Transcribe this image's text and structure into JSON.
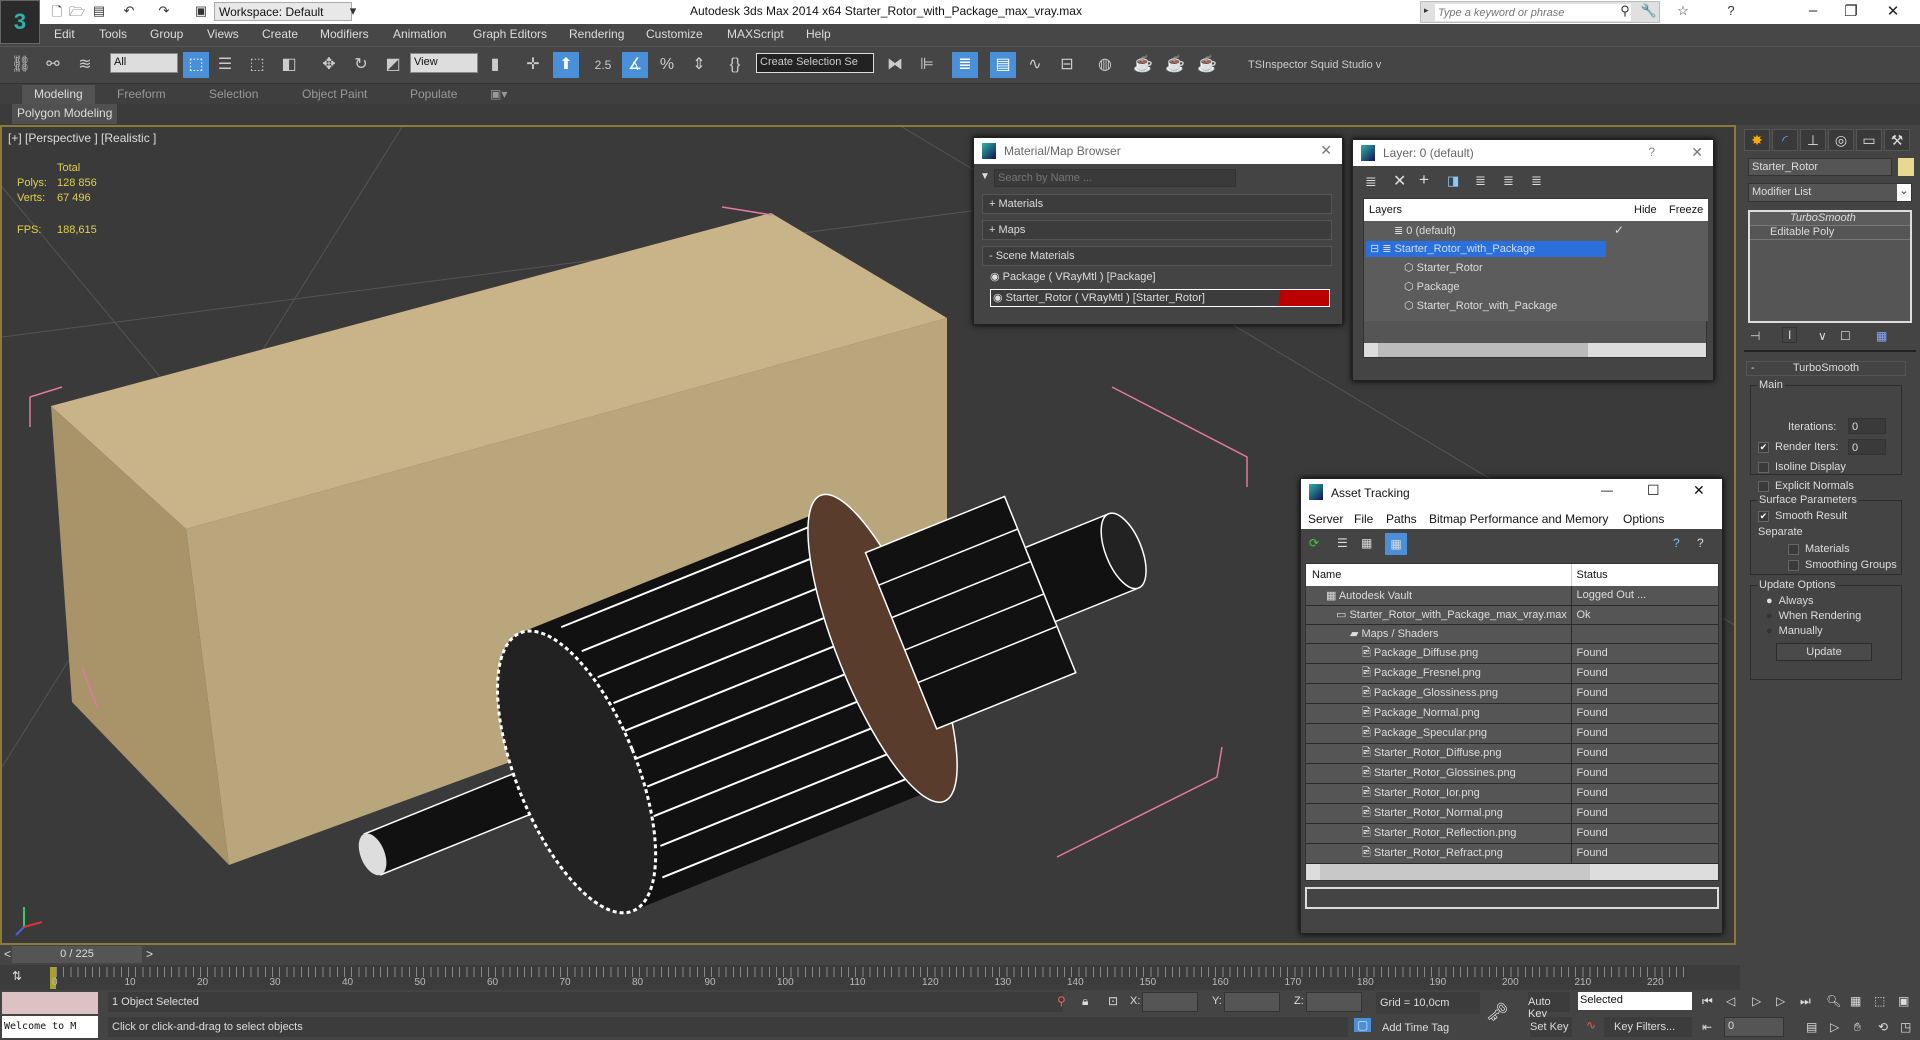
{
  "titlebar": {
    "workspace": "Workspace: Default",
    "title": "Autodesk 3ds Max  2014 x64    Starter_Rotor_with_Package_max_vray.max",
    "search_placeholder": "Type a keyword or phrase"
  },
  "menu": [
    "Edit",
    "Tools",
    "Group",
    "Views",
    "Create",
    "Modifiers",
    "Animation",
    "Graph Editors",
    "Rendering",
    "Customize",
    "MAXScript",
    "Help"
  ],
  "toolbar": {
    "filter": "All",
    "ref_coord": "View",
    "snap_label": "2.5",
    "selection_set": "Create Selection Se",
    "plugins": "TSInspector  Squid Studio v"
  },
  "ribbon": {
    "tabs": [
      "Modeling",
      "Freeform",
      "Selection",
      "Object Paint",
      "Populate"
    ],
    "active": "Modeling",
    "panel": "Polygon Modeling"
  },
  "viewport": {
    "label": "[+] [Perspective ] [Realistic ]",
    "stats": {
      "header": "Total",
      "polys_label": "Polys:",
      "polys": "128 856",
      "verts_label": "Verts:",
      "verts": "67 496",
      "fps_label": "FPS:",
      "fps": "188,615"
    }
  },
  "material_browser": {
    "title": "Material/Map Browser",
    "search_placeholder": "Search by Name ...",
    "sections": [
      "+ Materials",
      "+ Maps",
      "- Scene Materials"
    ],
    "items": [
      "Package  ( VRayMtl ) [Package]",
      "Starter_Rotor  ( VRayMtl ) [Starter_Rotor]"
    ]
  },
  "layers": {
    "title": "Layer: 0 (default)",
    "help": "?",
    "columns": [
      "Layers",
      "Hide",
      "Freeze"
    ],
    "rows": [
      "0 (default)",
      "Starter_Rotor_with_Package",
      "Starter_Rotor",
      "Package",
      "Starter_Rotor_with_Package"
    ]
  },
  "asset_tracking": {
    "title": "Asset Tracking",
    "menu": [
      "Server",
      "File",
      "Paths",
      "Bitmap Performance and Memory",
      "Options"
    ],
    "columns": [
      "Name",
      "Status"
    ],
    "rows": [
      {
        "name": "Autodesk Vault",
        "status": "Logged Out ..."
      },
      {
        "name": "Starter_Rotor_with_Package_max_vray.max",
        "status": "Ok"
      },
      {
        "name": "Maps / Shaders",
        "status": ""
      },
      {
        "name": "Package_Diffuse.png",
        "status": "Found"
      },
      {
        "name": "Package_Fresnel.png",
        "status": "Found"
      },
      {
        "name": "Package_Glossiness.png",
        "status": "Found"
      },
      {
        "name": "Package_Normal.png",
        "status": "Found"
      },
      {
        "name": "Package_Specular.png",
        "status": "Found"
      },
      {
        "name": "Starter_Rotor_Diffuse.png",
        "status": "Found"
      },
      {
        "name": "Starter_Rotor_Glossines.png",
        "status": "Found"
      },
      {
        "name": "Starter_Rotor_Ior.png",
        "status": "Found"
      },
      {
        "name": "Starter_Rotor_Normal.png",
        "status": "Found"
      },
      {
        "name": "Starter_Rotor_Reflection.png",
        "status": "Found"
      },
      {
        "name": "Starter_Rotor_Refract.png",
        "status": "Found"
      }
    ]
  },
  "command_panel": {
    "object_name": "Starter_Rotor",
    "object_color": "#e8d890",
    "modifier_list": "Modifier List",
    "stack": [
      "TurboSmooth",
      "Editable Poly"
    ],
    "rollout": "TurboSmooth",
    "main": "Main",
    "iterations_label": "Iterations:",
    "iterations": "0",
    "render_iters_label": "Render Iters:",
    "render_iters": "0",
    "isoline": "Isoline Display",
    "explicit_normals": "Explicit Normals",
    "surface": "Surface Parameters",
    "smooth_result": "Smooth Result",
    "separate": "Separate",
    "materials": "Materials",
    "smoothing_groups": "Smoothing Groups",
    "update_options": "Update Options",
    "always": "Always",
    "when_rendering": "When Rendering",
    "manually": "Manually",
    "update_btn": "Update"
  },
  "timeline": {
    "frame": "0 / 225",
    "ticks": [
      "0",
      "10",
      "20",
      "30",
      "40",
      "50",
      "60",
      "70",
      "80",
      "90",
      "100",
      "110",
      "120",
      "130",
      "140",
      "150",
      "160",
      "170",
      "180",
      "190",
      "200",
      "210",
      "220"
    ]
  },
  "status": {
    "selected": "1 Object Selected",
    "prompt": "Click or click-and-drag to select objects",
    "welcome": "Welcome to M",
    "x_label": "X:",
    "y_label": "Y:",
    "z_label": "Z:",
    "grid": "Grid = 10,0cm",
    "add_time_tag": "Add Time Tag",
    "auto_key": "Auto Key",
    "set_key": "Set Key",
    "key_mode": "Selected",
    "key_filters": "Key Filters...",
    "current_frame": "0"
  }
}
